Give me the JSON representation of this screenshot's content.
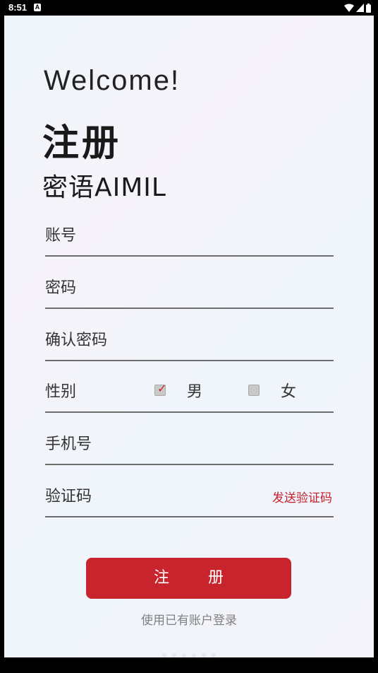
{
  "status_bar": {
    "time": "8:51",
    "notification_glyph": "A"
  },
  "header": {
    "welcome": "Welcome!",
    "title": "注册",
    "subtitle": "密语AIMIL"
  },
  "form": {
    "account_label": "账号",
    "password_label": "密码",
    "confirm_password_label": "确认密码",
    "gender_label": "性别",
    "gender_male": "男",
    "gender_female": "女",
    "gender_selected": "男",
    "phone_label": "手机号",
    "code_label": "验证码",
    "send_code": "发送验证码"
  },
  "actions": {
    "register_button": "注 册",
    "login_link": "使用已有账户登录"
  },
  "colors": {
    "accent": "#c8242d",
    "divider": "#6c6c6c"
  }
}
